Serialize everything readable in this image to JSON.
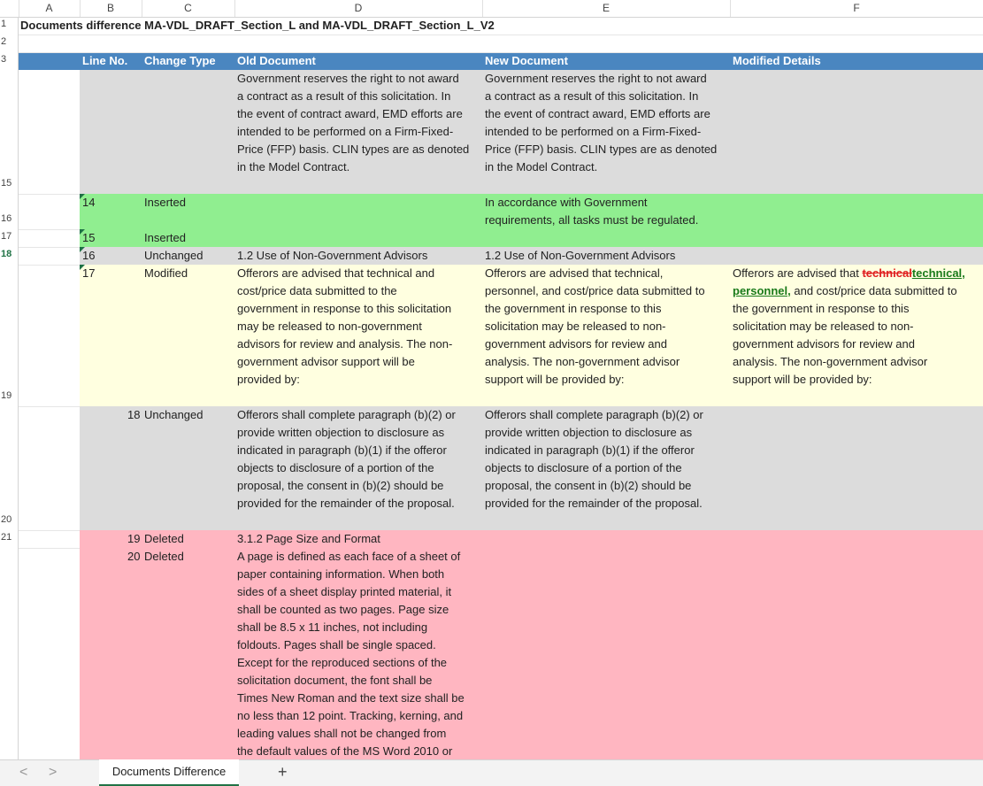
{
  "columns": [
    "A",
    "B",
    "C",
    "D",
    "E",
    "F"
  ],
  "row_numbers": {
    "r1": "1",
    "r2": "2",
    "r3": "3",
    "r15": "15",
    "r16": "16",
    "r17": "17",
    "r18": "18",
    "r19": "19",
    "r20": "20",
    "r21": "21"
  },
  "title": "Documents difference MA-VDL_DRAFT_Section_L and MA-VDL_DRAFT_Section_L_V2",
  "headers": {
    "line_no": "Line No.",
    "change_type": "Change Type",
    "old_doc": "Old Document",
    "new_doc": "New Document",
    "modified": "Modified Details"
  },
  "rows": {
    "r15": {
      "old": "Government reserves the right to not award\na contract as a result of this solicitation.  In\nthe event of contract award, EMD efforts are\nintended to be performed on a Firm-Fixed-\nPrice (FFP) basis. CLIN types are as denoted\nin the Model Contract.",
      "new": "Government reserves the right to not award\na contract as a result of this solicitation.  In\nthe event of contract award, EMD efforts are\nintended to be performed on a Firm-Fixed-\nPrice (FFP) basis. CLIN types are as denoted\nin the Model Contract."
    },
    "r16": {
      "line": "14",
      "type": "Inserted",
      "new": "In accordance with Government\nrequirements, all tasks must be regulated."
    },
    "r17": {
      "line": "15",
      "type": "Inserted"
    },
    "r18": {
      "line": "16",
      "type": "Unchanged",
      "old": "1.2 Use of Non-Government Advisors",
      "new": "1.2 Use of Non-Government Advisors"
    },
    "r19": {
      "line": "17",
      "type": "Modified",
      "old": "Offerors are advised that technical and\ncost/price data submitted to the\ngovernment in response to this solicitation\nmay be released to non-government\nadvisors for review and analysis. The non-\ngovernment advisor support will be\nprovided by:",
      "new": "Offerors are advised that technical,\npersonnel, and cost/price data submitted to\nthe government in response to this\nsolicitation may be released to non-\ngovernment advisors for review and\nanalysis. The non-government advisor\nsupport will be provided by:",
      "mod_pre": "Offerors are advised that ",
      "mod_del": "technical",
      "mod_ins1": "technical,",
      "mod_ins2": "personnel,",
      "mod_post1": " and cost/price data submitted to",
      "mod_rest": "the government in response to this\nsolicitation may be released to non-\ngovernment advisors for review and\nanalysis. The non-government advisor\nsupport will be provided by:"
    },
    "r20": {
      "line": "18",
      "type": "Unchanged",
      "old": "Offerors shall complete paragraph (b)(2) or\nprovide written objection to disclosure as\nindicated in paragraph (b)(1) if the offeror\nobjects to disclosure of a portion of the\nproposal, the consent in (b)(2) should be\nprovided for the remainder of the proposal.",
      "new": "Offerors shall complete paragraph (b)(2) or\nprovide written objection to disclosure as\nindicated in paragraph (b)(1) if the offeror\nobjects to disclosure of a portion of the\nproposal, the consent in (b)(2) should be\nprovided for the remainder of the proposal."
    },
    "r21": {
      "line": "19",
      "type": "Deleted",
      "old": "3.1.2 Page Size and Format"
    },
    "r22": {
      "line": "20",
      "type": "Deleted",
      "old": "A page is defined as each face of a sheet of\npaper containing information.  When both\nsides of a sheet display printed material, it\nshall be counted as two pages.  Page size\nshall be 8.5 x 11 inches, not including\nfoldouts. Pages shall be single spaced.\nExcept for the reproduced sections of the\nsolicitation document, the font shall be\nTimes New Roman and the text size shall be\nno less than 12 point.  Tracking, kerning, and\nleading values shall not be changed from\nthe default values of the MS Word 2010 or"
    }
  },
  "sheet_tab": "Documents Difference",
  "nav": {
    "prev": "<",
    "next": ">",
    "add": "+"
  }
}
